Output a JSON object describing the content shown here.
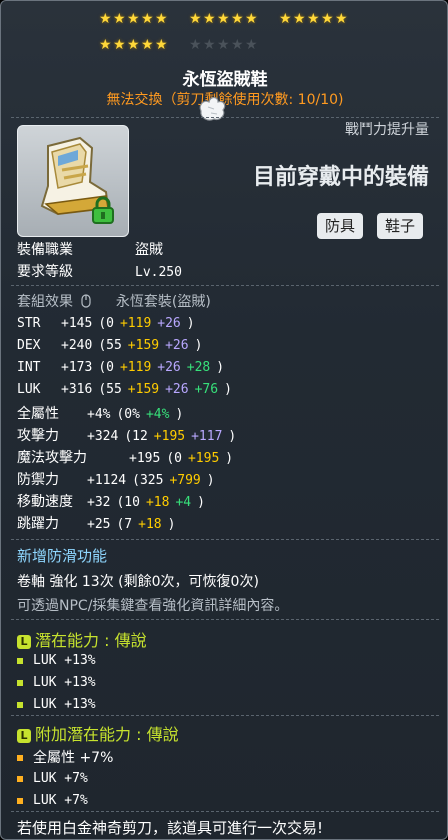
{
  "item": {
    "name": "永恆盜賊鞋",
    "trade_note": "無法交換（剪刀剩餘使用次數: 10/10)",
    "stars": {
      "filled": 20,
      "total": 25
    }
  },
  "panel": {
    "combat_power_label": "戰鬥力提升量",
    "equipped_label": "目前穿戴中的裝備",
    "tags": [
      "防具",
      "鞋子"
    ]
  },
  "requirements": {
    "job_label": "裝備職業",
    "job_value": "盜賊",
    "level_label": "要求等級",
    "level_value": "Lv.250"
  },
  "set": {
    "label": "套組效果",
    "value": "永恆套裝(盜賊)"
  },
  "stats": [
    {
      "name": "STR",
      "total": "+145",
      "base": "(0",
      "p1": "+119",
      "p2": "+26",
      "p3": "",
      "end": ")"
    },
    {
      "name": "DEX",
      "total": "+240",
      "base": "(55",
      "p1": "+159",
      "p2": "+26",
      "p3": "",
      "end": ")"
    },
    {
      "name": "INT",
      "total": "+173",
      "base": "(0",
      "p1": "+119",
      "p2": "+26",
      "p3": "+28",
      "end": ")"
    },
    {
      "name": "LUK",
      "total": "+316",
      "base": "(55",
      "p1": "+159",
      "p2": "+26",
      "p3": "+76",
      "end": ")"
    }
  ],
  "stats2": [
    {
      "name": "全屬性",
      "total": "+4%",
      "base": "(0%",
      "p1": "",
      "p2": "",
      "p3": "+4%",
      "end": ")"
    },
    {
      "name": "攻擊力",
      "total": "+324",
      "base": "(12",
      "p1": "+195",
      "p2": "+117",
      "p3": "",
      "end": ")"
    },
    {
      "name": "魔法攻擊力",
      "total": "+195",
      "base": "(0",
      "p1": "+195",
      "p2": "",
      "p3": "",
      "end": ")"
    },
    {
      "name": "防禦力",
      "total": "+1124",
      "base": "(325",
      "p1": "+799",
      "p2": "",
      "p3": "",
      "end": ")"
    },
    {
      "name": "移動速度",
      "total": "+32",
      "base": "(10",
      "p1": "+18",
      "p2": "",
      "p3": "+4",
      "end": ")"
    },
    {
      "name": "跳躍力",
      "total": "+25",
      "base": "(7",
      "p1": "+18",
      "p2": "",
      "p3": "",
      "end": ")"
    }
  ],
  "extra": {
    "anti_slip": "新增防滑功能",
    "upgrade_line": "卷軸 強化 13次 (剩餘0次，可恢復0次)",
    "info_line": "可透過NPC/採集鍵查看強化資訊詳細內容。"
  },
  "potential": {
    "badge": "L",
    "title": "潛在能力 : 傳說",
    "lines": [
      "LUK +13%",
      "LUK +13%",
      "LUK +13%"
    ]
  },
  "bonus_potential": {
    "badge": "L",
    "title": "附加潛在能力 : 傳說",
    "lines": [
      "全屬性 +7%",
      "LUK +7%",
      "LUK +7%"
    ]
  },
  "footer": "若使用白金神奇剪刀，該道具可進行一次交易!",
  "colors": {
    "gold_star": "#ffd83a",
    "gray_star": "#4a525a",
    "trade_note": "#ff9a20",
    "legendary": "#c6e22e"
  }
}
